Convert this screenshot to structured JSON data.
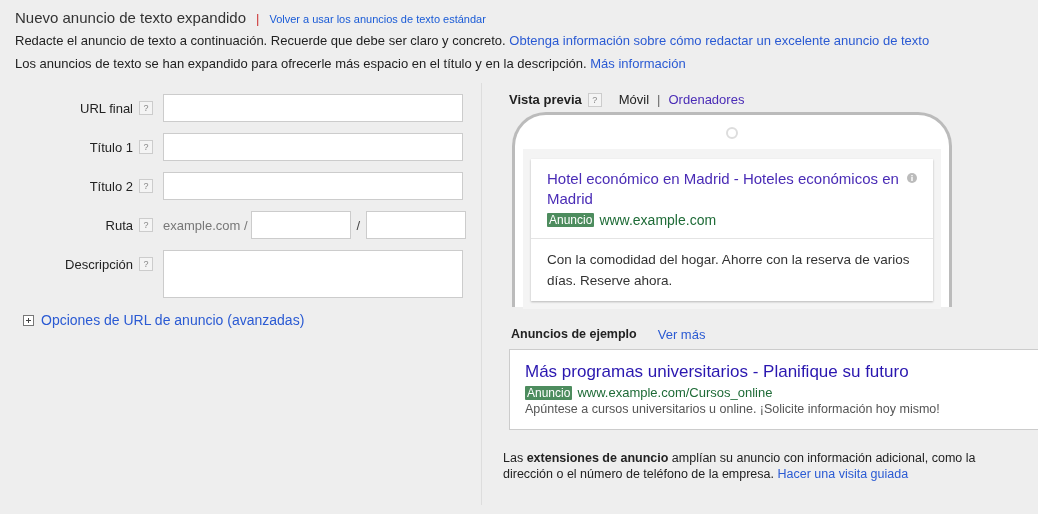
{
  "header": {
    "title": "Nuevo anuncio de texto expandido",
    "separator": "|",
    "switch_link": "Volver a usar los anuncios de texto estándar"
  },
  "intro": [
    {
      "text": "Redacte el anuncio de texto a continuación. Recuerde que debe ser claro y concreto.",
      "link": "Obtenga información sobre cómo redactar un excelente anuncio de texto"
    },
    {
      "text": "Los anuncios de texto se han expandido para ofrecerle más espacio en el título y en la descripción.",
      "link": "Más información"
    }
  ],
  "form": {
    "fields": [
      {
        "kind": "text",
        "label": "URL final",
        "help": "?"
      },
      {
        "kind": "text",
        "label": "Título 1",
        "help": "?"
      },
      {
        "kind": "text",
        "label": "Título 2",
        "help": "?"
      },
      {
        "kind": "path",
        "label": "Ruta",
        "help": "?",
        "prefix": "example.com /",
        "separator": "/"
      },
      {
        "kind": "textarea",
        "label": "Descripción",
        "help": "?"
      }
    ],
    "advanced": {
      "expanded": false,
      "label": "Opciones de URL de anuncio (avanzadas)"
    }
  },
  "preview": {
    "title": "Vista previa",
    "help": "?",
    "tab_separator": "|",
    "tabs": [
      {
        "label": "Móvil",
        "selected": true
      },
      {
        "label": "Ordenadores",
        "selected": false
      }
    ],
    "ad": {
      "headline": "Hotel económico en Madrid - Hoteles económicos en Madrid",
      "badge": "Anuncio",
      "url": "www.example.com",
      "description": "Con la comodidad del hogar. Ahorre con la reserva de varios días. Reserve ahora."
    }
  },
  "examples": {
    "title": "Anuncios de ejemplo",
    "more": "Ver más",
    "ad": {
      "headline": "Más programas universitarios - Planifique su futuro",
      "badge": "Anuncio",
      "url": "www.example.com/Cursos_online",
      "description": "Apúntese a cursos universitarios u online. ¡Solicite información hoy mismo!"
    }
  },
  "extensions": {
    "text": "Las **extensiones de anuncio** amplían su anuncio con información adicional, como la dirección o el número de teléfono de la empresa.",
    "link": "Hacer una visita guiada"
  }
}
